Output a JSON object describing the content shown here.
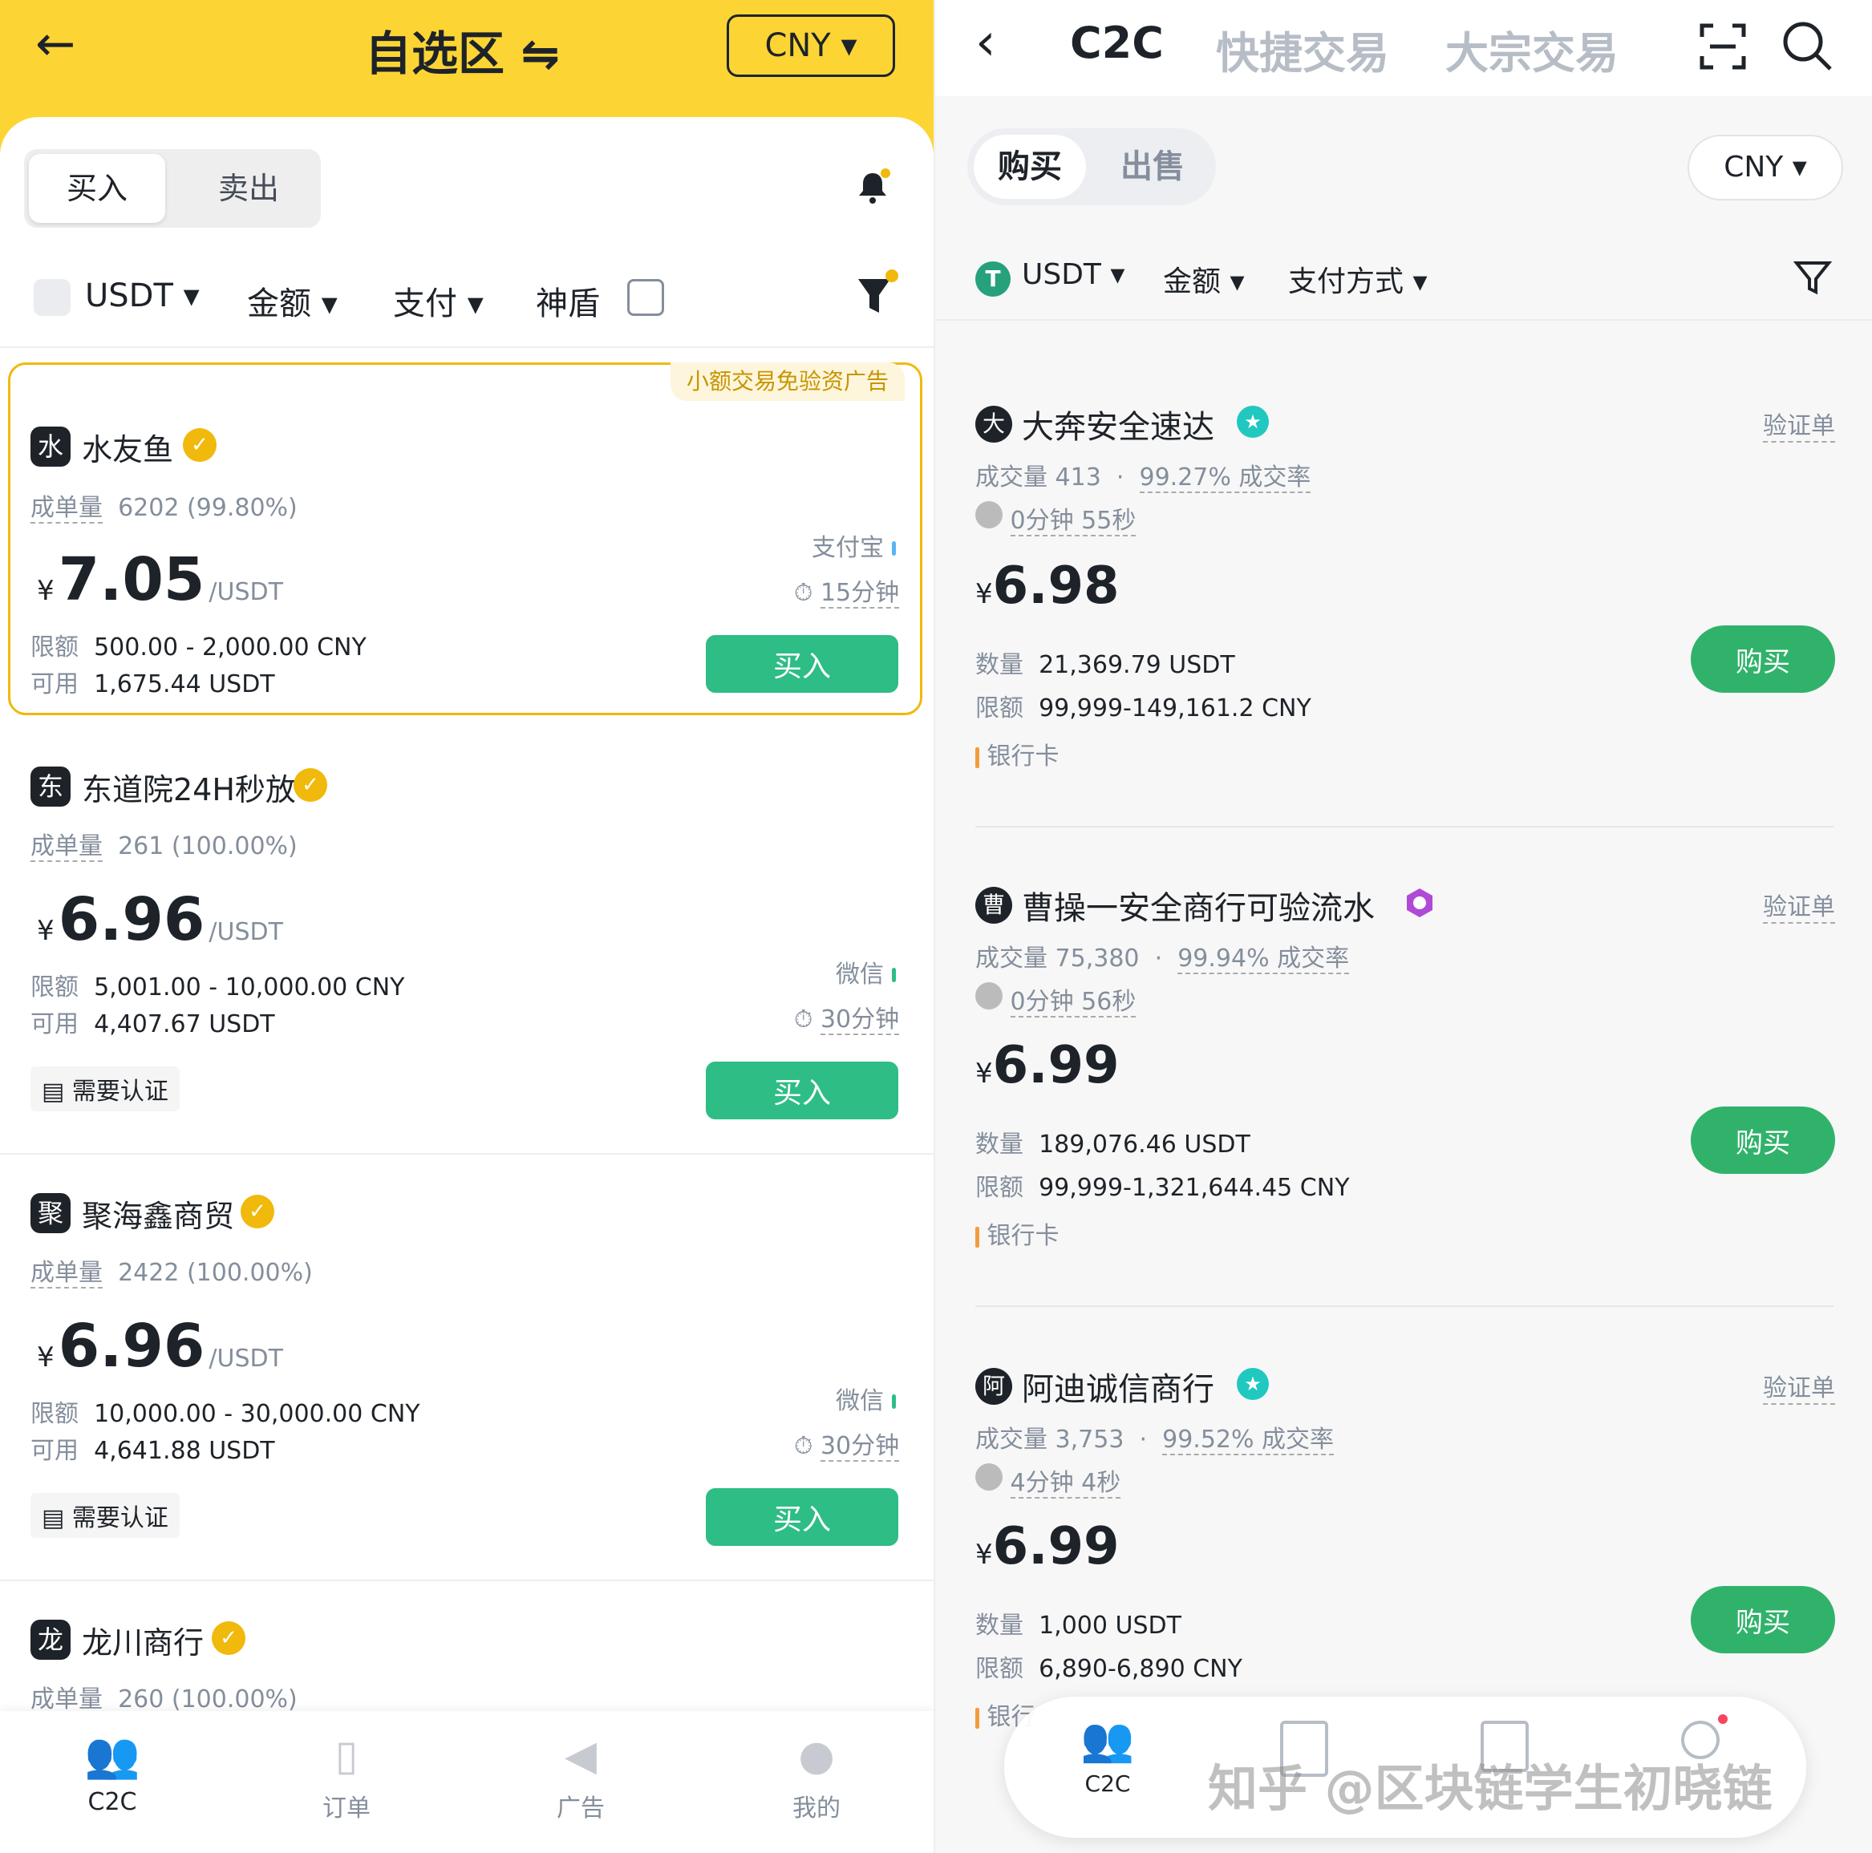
{
  "left": {
    "title": "自选区",
    "swap_glyph": "⇋",
    "currency": "CNY",
    "tabs": [
      "买入",
      "卖出"
    ],
    "filters": {
      "coin": "USDT",
      "amount": "金额",
      "pay": "支付",
      "shield": "神盾"
    },
    "promo": "小额交易免验资广告",
    "ads": [
      {
        "avatar": "水",
        "name": "水友鱼",
        "orders_label": "成单量",
        "orders": "6202 (99.80%)",
        "price": "7.05",
        "unit": "/USDT",
        "limit_label": "限额",
        "limit": "500.00 - 2,000.00 CNY",
        "avail_label": "可用",
        "avail": "1,675.44 USDT",
        "pay": "支付宝",
        "time": "15分钟",
        "btn": "买入"
      },
      {
        "avatar": "东",
        "name": "东道院24H秒放",
        "orders_label": "成单量",
        "orders": "261 (100.00%)",
        "price": "6.96",
        "unit": "/USDT",
        "limit_label": "限额",
        "limit": "5,001.00 - 10,000.00 CNY",
        "avail_label": "可用",
        "avail": "4,407.67 USDT",
        "pay": "微信",
        "time": "30分钟",
        "btn": "买入",
        "tag": "需要认证"
      },
      {
        "avatar": "聚",
        "name": "聚海鑫商贸",
        "orders_label": "成单量",
        "orders": "2422 (100.00%)",
        "price": "6.96",
        "unit": "/USDT",
        "limit_label": "限额",
        "limit": "10,000.00 - 30,000.00 CNY",
        "avail_label": "可用",
        "avail": "4,641.88 USDT",
        "pay": "微信",
        "time": "30分钟",
        "btn": "买入",
        "tag": "需要认证"
      },
      {
        "avatar": "龙",
        "name": "龙川商行",
        "orders_label": "成单量",
        "orders": "260 (100.00%)"
      }
    ],
    "currency_symbol": "¥",
    "nav": [
      "C2C",
      "订单",
      "广告",
      "我的"
    ]
  },
  "right": {
    "tabs": [
      "C2C",
      "快捷交易",
      "大宗交易"
    ],
    "seg": [
      "购买",
      "出售"
    ],
    "currency": "CNY",
    "filters": {
      "coin": "USDT",
      "amount": "金额",
      "pay": "支付方式"
    },
    "ads": [
      {
        "avatar": "大",
        "name": "大奔安全速达",
        "verify": "验证单",
        "vol": "成交量 413",
        "rate": "99.27% 成交率",
        "time": "0分钟 55秒",
        "price": "6.98",
        "qty_label": "数量",
        "qty": "21,369.79 USDT",
        "limit_label": "限额",
        "limit": "99,999-149,161.2 CNY",
        "pay": "银行卡",
        "btn": "购买"
      },
      {
        "avatar": "曹",
        "name": "曹操一安全商行可验流水",
        "verify": "验证单",
        "vol": "成交量 75,380",
        "rate": "99.94% 成交率",
        "time": "0分钟 56秒",
        "price": "6.99",
        "qty_label": "数量",
        "qty": "189,076.46 USDT",
        "limit_label": "限额",
        "limit": "99,999-1,321,644.45 CNY",
        "pay": "银行卡",
        "btn": "购买"
      },
      {
        "avatar": "阿",
        "name": "阿迪诚信商行",
        "verify": "验证单",
        "vol": "成交量 3,753",
        "rate": "99.52% 成交率",
        "time": "4分钟 4秒",
        "price": "6.99",
        "qty_label": "数量",
        "qty": "1,000 USDT",
        "limit_label": "限额",
        "limit": "6,890-6,890 CNY",
        "pay": "银行",
        "btn": "购买"
      }
    ],
    "currency_symbol": "¥",
    "dot": "·",
    "nav": {
      "active": "C2C"
    },
    "watermark": "知乎 @区块链学生初晓链"
  },
  "colors": {
    "brand_yellow": "#fcd535",
    "buy_green": "#2ebd85",
    "right_green": "#31b26b",
    "gold": "#f0b90b"
  }
}
